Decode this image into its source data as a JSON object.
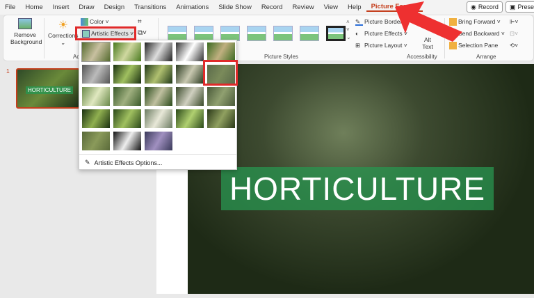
{
  "menu": {
    "tabs": [
      "File",
      "Home",
      "Insert",
      "Draw",
      "Design",
      "Transitions",
      "Animations",
      "Slide Show",
      "Record",
      "Review",
      "View",
      "Help",
      "Picture Format"
    ],
    "active": "Picture Format",
    "record": "Record",
    "present": "Present"
  },
  "ribbon": {
    "remove_bg": "Remove Background",
    "corrections": "Corrections",
    "color": "Color",
    "artistic": "Artistic Effects",
    "adjust_group": "Adjust",
    "styles_group": "Picture Styles",
    "border": "Picture Border",
    "effects": "Picture Effects",
    "layout": "Picture Layout",
    "alt": "Alt Text",
    "access_group": "Accessibility",
    "forward": "Bring Forward",
    "backward": "Send Backward",
    "selection": "Selection Pane",
    "arrange_group": "Arrange"
  },
  "slides": {
    "number": "1",
    "thumb_title": "HORTICULTURE"
  },
  "slide": {
    "title": "HORTICULTURE"
  },
  "gallery": {
    "options_label": "Artistic Effects Options...",
    "effects": [
      "None",
      "Marker",
      "Pencil Grayscale",
      "Pencil Sketch",
      "Line Drawing",
      "Chalk Sketch",
      "Paint Strokes",
      "Paint Brush",
      "Glow Diffused",
      "Blur",
      "Light Screen",
      "Watercolor Sponge",
      "Film Grain",
      "Mosaic Bubbles",
      "Glass",
      "Cement",
      "Texturizer",
      "Crisscross Etching",
      "Pastels Smooth",
      "Plastic Wrap",
      "Cutout",
      "Photocopy",
      "Glow Edges"
    ]
  },
  "colors": {
    "accent": "#c43e1c",
    "highlight": "#e02a2a"
  }
}
